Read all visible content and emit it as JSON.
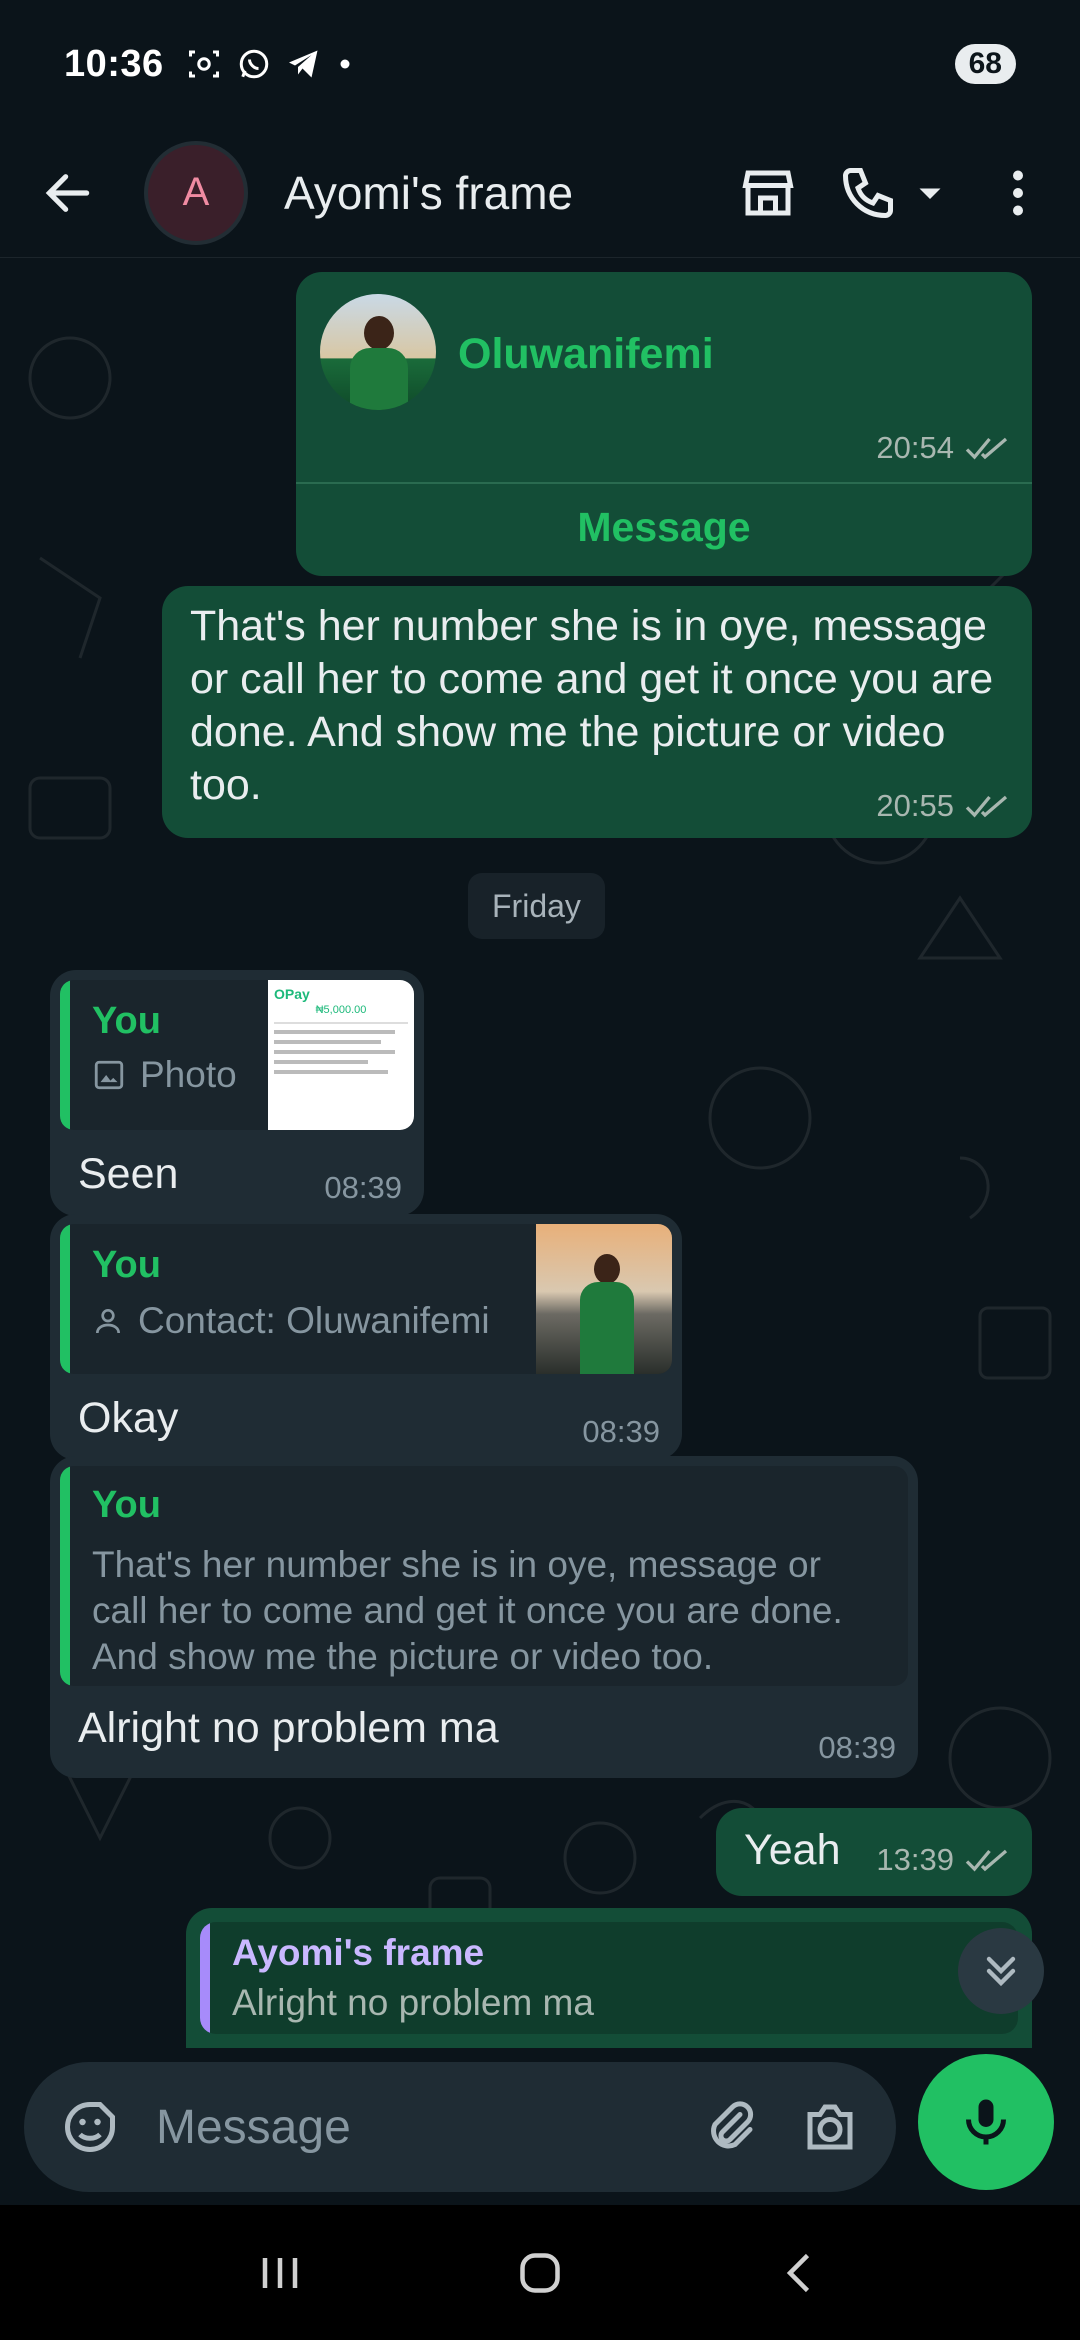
{
  "status_bar": {
    "time": "10:36",
    "battery": "68"
  },
  "header": {
    "avatar_letter": "A",
    "title": "Ayomi's frame"
  },
  "messages": {
    "contact_card": {
      "name": "Oluwanifemi",
      "time": "20:54",
      "action": "Message"
    },
    "out_long": {
      "text": "That's her number she is in oye, message or call her to come and get it once you are done. And show me the picture or video too.",
      "time": "20:55"
    },
    "date_chip": "Friday",
    "reply1": {
      "author": "You",
      "sub": "Photo",
      "text": "Seen",
      "time": "08:39"
    },
    "reply2": {
      "author": "You",
      "sub": "Contact: Oluwanifemi",
      "text": "Okay",
      "time": "08:39"
    },
    "reply3": {
      "author": "You",
      "quote": "That's her number she is in oye, message or call her to come and get it once you are done. And show me the picture or video too.",
      "text": "Alright no problem ma",
      "time": "08:39"
    },
    "out_yeah": {
      "text": "Yeah",
      "time": "13:39"
    },
    "reply_preview": {
      "author": "Ayomi's frame",
      "text": "Alright no problem ma"
    }
  },
  "receipt": {
    "brand": "OPay",
    "amount": "₦5,000.00"
  },
  "input": {
    "placeholder": "Message"
  },
  "colors": {
    "accent": "#21c063",
    "outgoing": "#134d37",
    "incoming": "#1f2c34",
    "background": "#0b141a"
  }
}
